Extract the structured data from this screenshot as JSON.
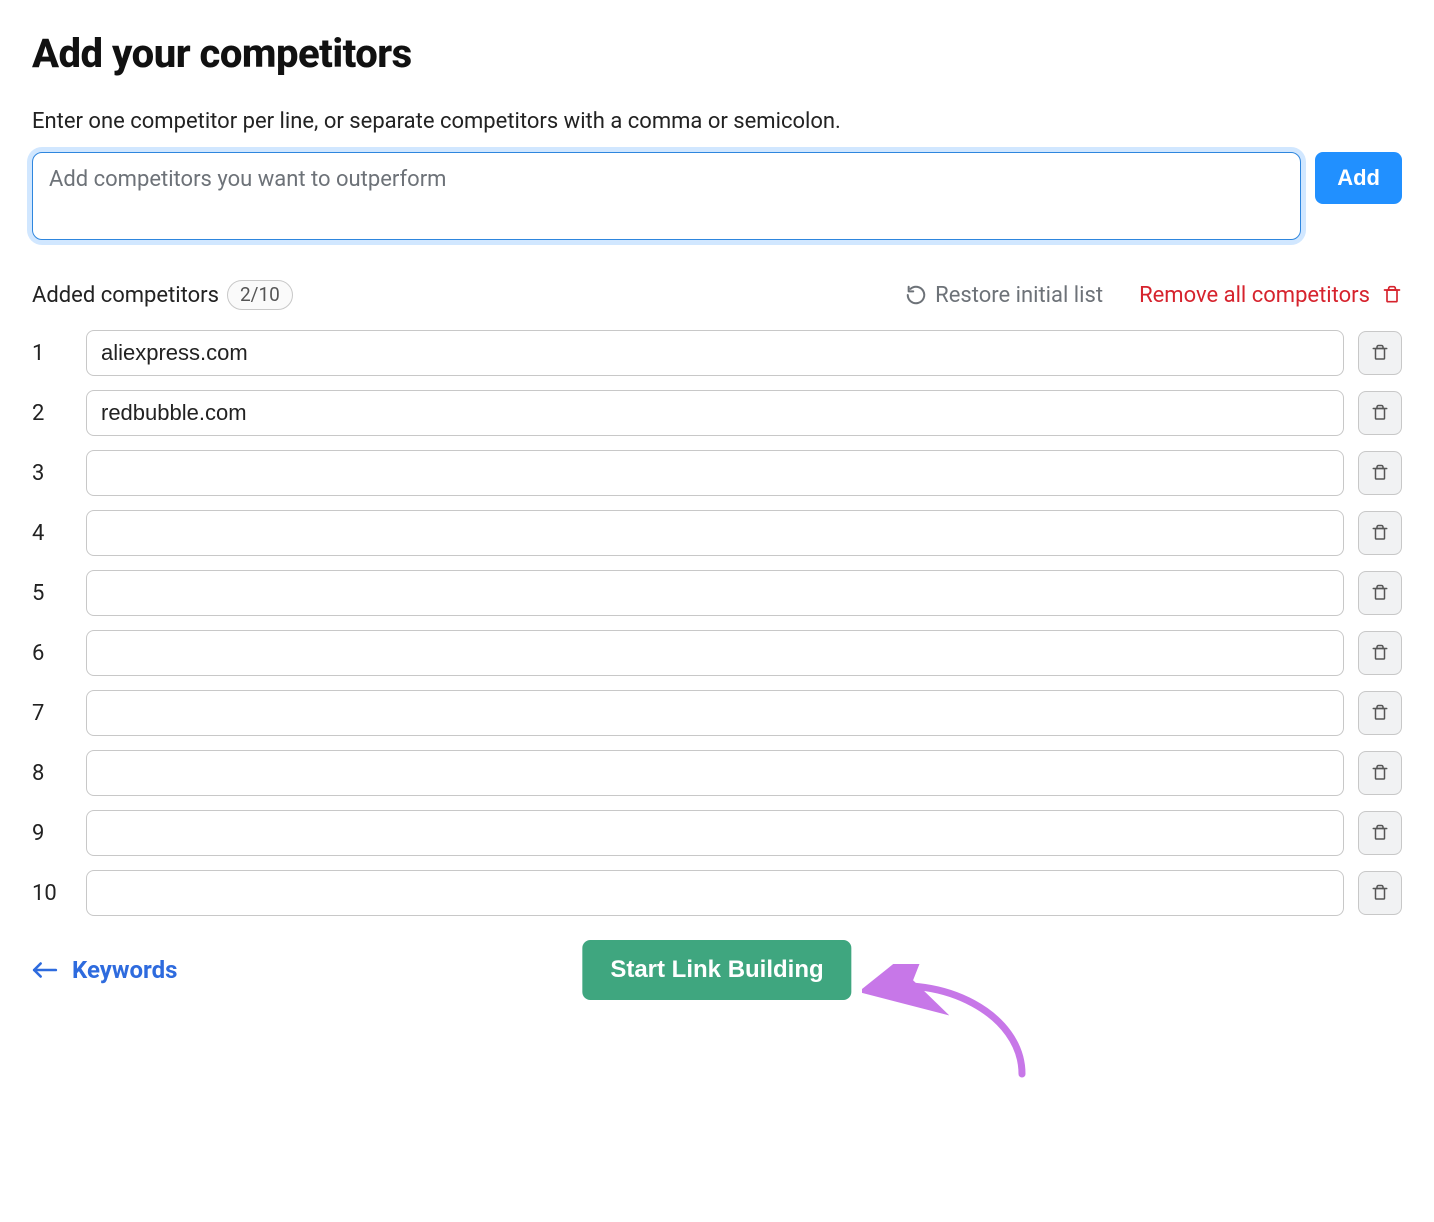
{
  "title": "Add your competitors",
  "instructions": "Enter one competitor per line, or separate competitors with a comma or semicolon.",
  "input": {
    "placeholder": "Add competitors you want to outperform",
    "add_label": "Add"
  },
  "list_header": {
    "label": "Added competitors",
    "count": "2/10",
    "restore_label": "Restore initial list",
    "remove_all_label": "Remove all competitors"
  },
  "rows": [
    {
      "n": "1",
      "value": "aliexpress.com"
    },
    {
      "n": "2",
      "value": "redbubble.com"
    },
    {
      "n": "3",
      "value": ""
    },
    {
      "n": "4",
      "value": ""
    },
    {
      "n": "5",
      "value": ""
    },
    {
      "n": "6",
      "value": ""
    },
    {
      "n": "7",
      "value": ""
    },
    {
      "n": "8",
      "value": ""
    },
    {
      "n": "9",
      "value": ""
    },
    {
      "n": "10",
      "value": ""
    }
  ],
  "footer": {
    "back_label": "Keywords",
    "primary_label": "Start Link Building"
  },
  "colors": {
    "accent_blue": "#2190ff",
    "link_blue": "#2e6bde",
    "danger_red": "#d6232d",
    "primary_green": "#3fa67f",
    "annotation_purple": "#c777e8"
  }
}
